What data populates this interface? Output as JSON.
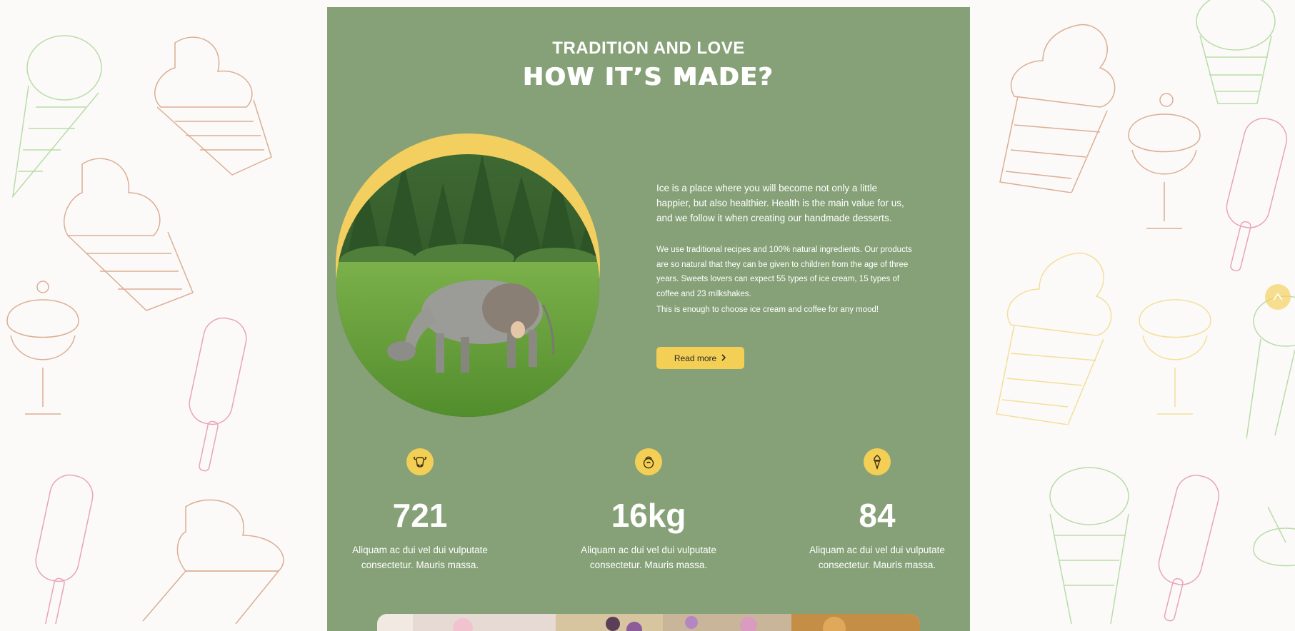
{
  "section": {
    "eyebrow": "TRADITION AND LOVE",
    "headline": "HOW IT’S MADE?"
  },
  "about": {
    "intro": "Ice is a place where you will become not only a little happier, but also healthier. Health is the main value for us, and we follow it when creating our handmade desserts.",
    "details": "We use traditional recipes and 100% natural ingredients. Our products are so natural that they can be given to children from the age of three years. Sweets lovers can expect 55 types of ice cream, 15 types of coffee and 23 milkshakes.",
    "closing": "This is enough to choose ice cream and coffee for any mood!",
    "button_label": "Read more"
  },
  "stats": [
    {
      "icon": "cow-icon",
      "value": "721",
      "desc": "Aliquam ac dui vel dui vulputate consectetur. Mauris massa."
    },
    {
      "icon": "kettlebell-icon",
      "value": "16kg",
      "desc": "Aliquam ac dui vel dui vulputate consectetur. Mauris massa."
    },
    {
      "icon": "ice-cream-icon",
      "value": "84",
      "desc": "Aliquam ac dui vel dui vulputate consectetur. Mauris massa."
    }
  ],
  "scroll_top_icon": "chevron-up-icon",
  "colors": {
    "panel": "#86a177",
    "accent": "#f4cf55",
    "background": "#fbfaf9"
  }
}
